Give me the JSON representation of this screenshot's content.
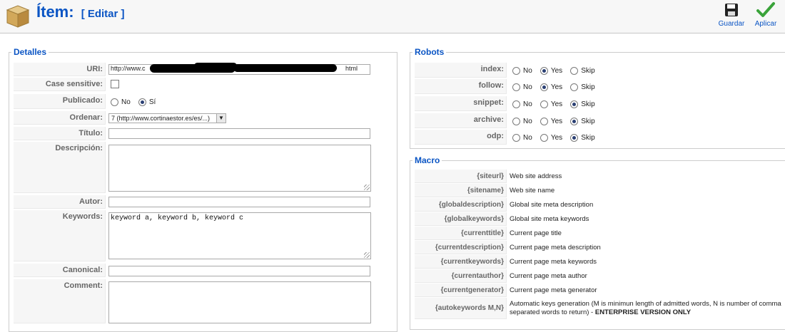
{
  "header": {
    "title": "Ítem:",
    "subtitle": "[ Editar ]",
    "save_label": "Guardar",
    "apply_label": "Aplicar"
  },
  "detalles": {
    "legend": "Detalles",
    "uri": {
      "label": "URI:",
      "value_start": "http://www.c",
      "value_end": "html"
    },
    "case_sensitive": {
      "label": "Case sensitive:"
    },
    "publicado": {
      "label": "Publicado:",
      "options": [
        "No",
        "Sí"
      ],
      "selected": "Sí"
    },
    "ordenar": {
      "label": "Ordenar:",
      "value": "7 (http://www.cortinaestor.es/es/...)"
    },
    "titulo": {
      "label": "Título:",
      "value": ""
    },
    "descripcion": {
      "label": "Descripción:",
      "value": ""
    },
    "autor": {
      "label": "Autor:",
      "value": ""
    },
    "keywords": {
      "label": "Keywords:",
      "value": "keyword a, keyword b, keyword c"
    },
    "canonical": {
      "label": "Canonical:",
      "value": ""
    },
    "comment": {
      "label": "Comment:",
      "value": ""
    }
  },
  "robots": {
    "legend": "Robots",
    "options": [
      "No",
      "Yes",
      "Skip"
    ],
    "rows": [
      {
        "label": "index:",
        "selected": "Yes"
      },
      {
        "label": "follow:",
        "selected": "Yes"
      },
      {
        "label": "snippet:",
        "selected": "Skip"
      },
      {
        "label": "archive:",
        "selected": "Skip"
      },
      {
        "label": "odp:",
        "selected": "Skip"
      }
    ]
  },
  "macro": {
    "legend": "Macro",
    "rows": [
      {
        "key": "{siteurl}",
        "desc": "Web site address"
      },
      {
        "key": "{sitename}",
        "desc": "Web site name"
      },
      {
        "key": "{globaldescription}",
        "desc": "Global site meta description"
      },
      {
        "key": "{globalkeywords}",
        "desc": "Global site meta keywords"
      },
      {
        "key": "{currenttitle}",
        "desc": "Current page title"
      },
      {
        "key": "{currentdescription}",
        "desc": "Current page meta description"
      },
      {
        "key": "{currentkeywords}",
        "desc": "Current page meta keywords"
      },
      {
        "key": "{currentauthor}",
        "desc": "Current page meta author"
      },
      {
        "key": "{currentgenerator}",
        "desc": "Current page meta generator"
      },
      {
        "key": "{autokeywords M,N}",
        "desc": "Automatic keys generation (M is minimun length of admitted words, N is number of comma separated words to return) - ",
        "desc_bold": "ENTERPRISE VERSION ONLY"
      }
    ]
  },
  "colors": {
    "accent": "#0b55c4",
    "key_bg": "#f6f6f6",
    "border": "#cccccc"
  }
}
